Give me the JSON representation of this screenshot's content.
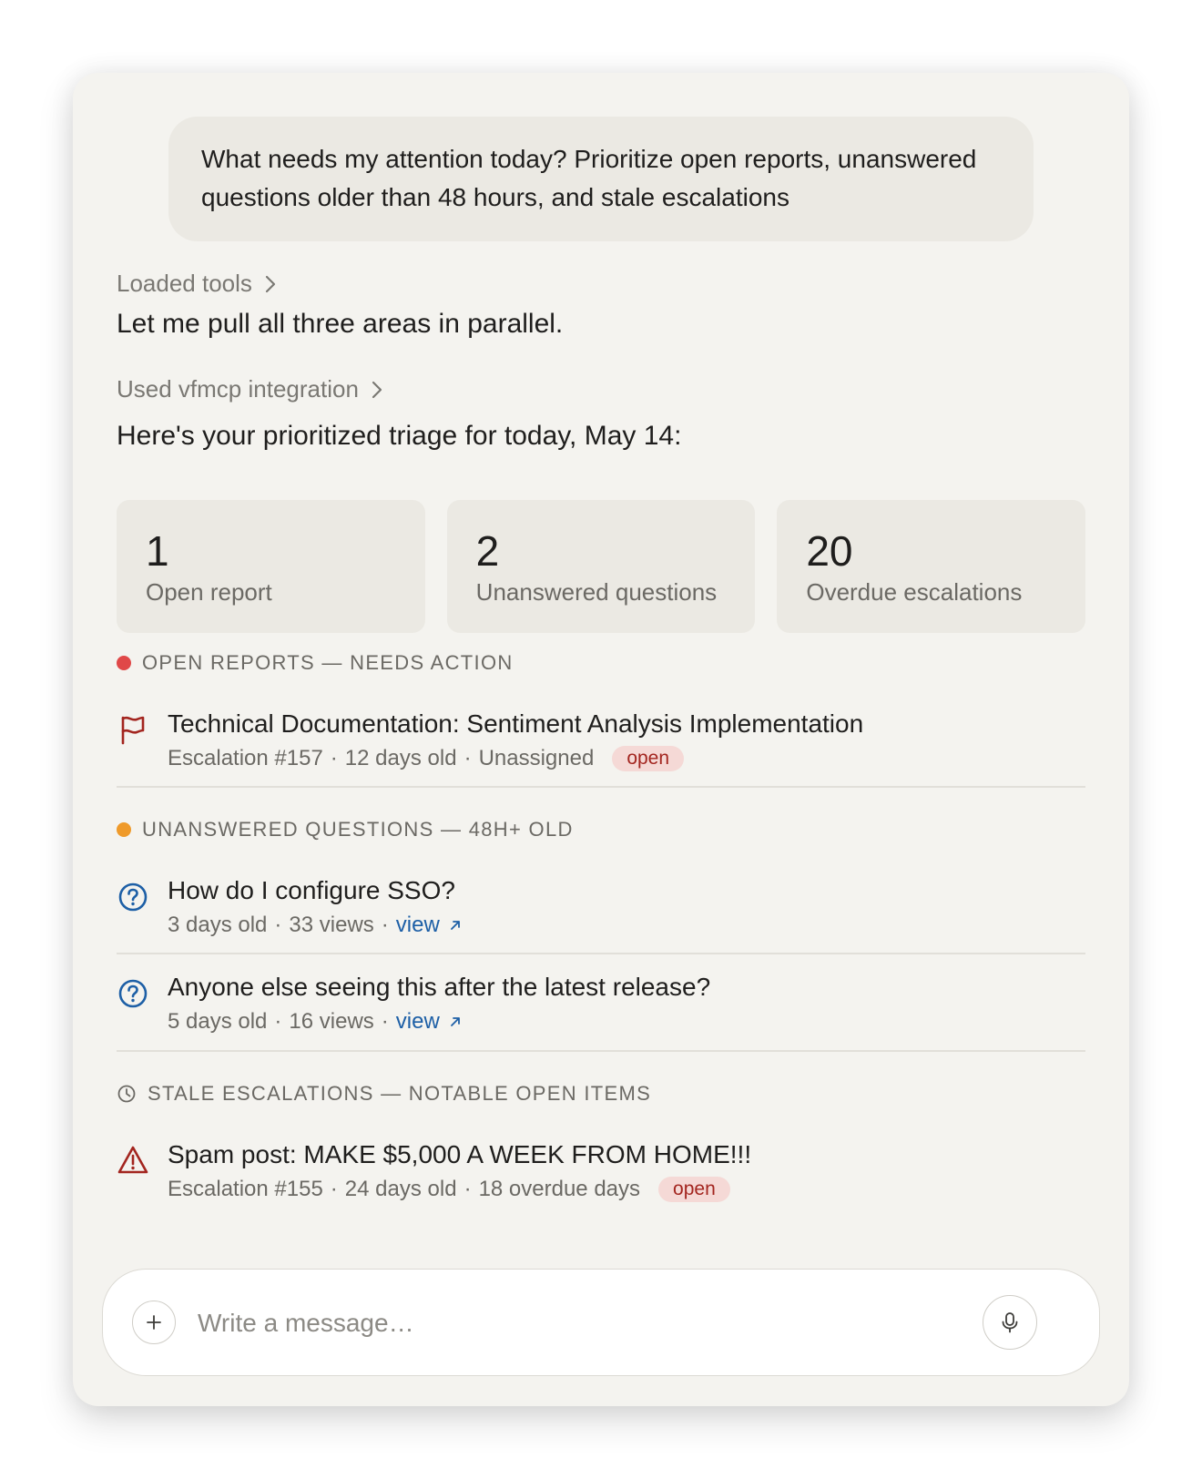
{
  "user_message": "What needs my attention today? Prioritize open reports, unanswered questions older than 48 hours, and stale escalations",
  "assistant": {
    "loaded_tools_label": "Loaded tools",
    "intro": "Let me pull all three areas in parallel.",
    "used_integration_label": "Used vfmcp integration",
    "summary": "Here's your prioritized triage for today, May 14:"
  },
  "stats": [
    {
      "value": "1",
      "label": "Open report"
    },
    {
      "value": "2",
      "label": "Unanswered questions"
    },
    {
      "value": "20",
      "label": "Overdue escalations"
    }
  ],
  "sections": {
    "open_reports": {
      "heading": "OPEN REPORTS — NEEDS ACTION",
      "color": "#e04848",
      "items": [
        {
          "icon": "flag-icon",
          "title": "Technical Documentation: Sentiment Analysis Implementation",
          "escalation": "Escalation #157",
          "age": "12 days old",
          "assignee": "Unassigned",
          "badge": "open"
        }
      ]
    },
    "unanswered": {
      "heading": "UNANSWERED QUESTIONS — 48H+ OLD",
      "color": "#ef9a2a",
      "items": [
        {
          "icon": "question-circle-icon",
          "title": "How do I configure SSO?",
          "age": "3 days old",
          "views": "33 views",
          "link": "view"
        },
        {
          "icon": "question-circle-icon",
          "title": "Anyone else seeing this after the latest release?",
          "age": "5 days old",
          "views": "16 views",
          "link": "view"
        }
      ]
    },
    "stale": {
      "heading": "STALE ESCALATIONS — NOTABLE OPEN ITEMS",
      "icon": "clock-icon",
      "items": [
        {
          "icon": "warning-triangle-icon",
          "title": "Spam post: MAKE $5,000 A WEEK FROM HOME!!!",
          "escalation": "Escalation #155",
          "age": "24 days old",
          "overdue": "18 overdue days",
          "badge": "open"
        }
      ]
    }
  },
  "meta_separator": "·",
  "composer": {
    "placeholder": "Write a message…"
  },
  "colors": {
    "accent_red": "#a3251f",
    "link_blue": "#1d5fa6",
    "question_blue": "#1d5fa6"
  }
}
